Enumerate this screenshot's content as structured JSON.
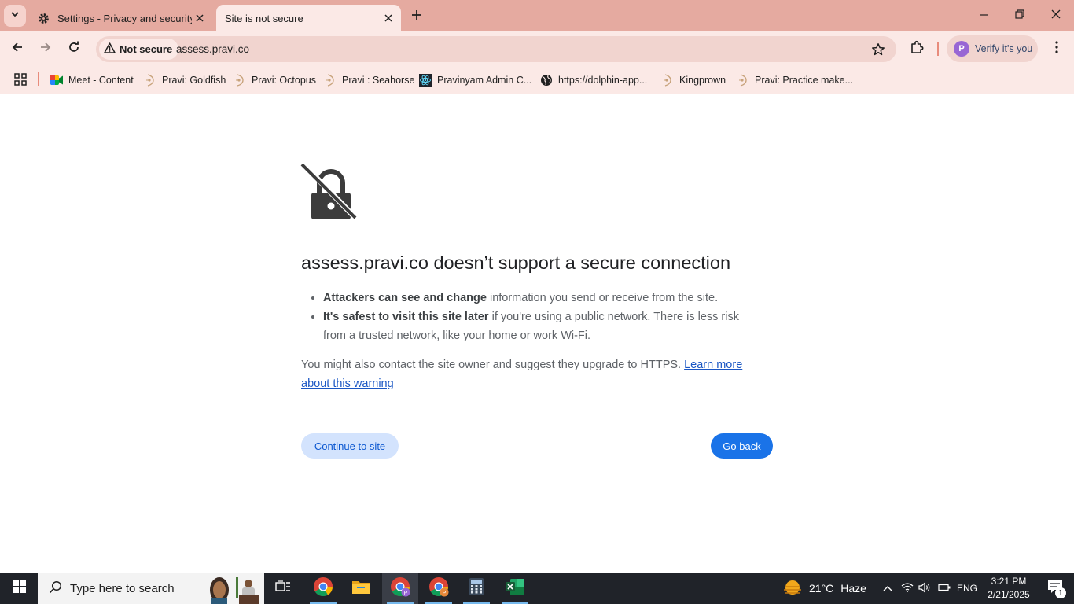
{
  "browser": {
    "tabs": [
      {
        "title": "Settings - Privacy and security",
        "icon": "gear-icon",
        "active": false
      },
      {
        "title": "Site is not secure",
        "icon": null,
        "active": true
      }
    ],
    "omnibox": {
      "security_chip": "Not secure",
      "url": "assess.pravi.co"
    },
    "profile": {
      "initial": "P",
      "label": "Verify it's you",
      "avatar_color": "#9866d4"
    },
    "frame_color": "#e5aaa0",
    "toolbar_color": "#fbe9e6"
  },
  "bookmarks": [
    {
      "label": "Meet - Content",
      "icon": "google-meet-icon"
    },
    {
      "label": "Pravi: Goldfish",
      "icon": "pravi-logo-icon"
    },
    {
      "label": "Pravi: Octopus",
      "icon": "pravi-logo-icon"
    },
    {
      "label": "Pravi : Seahorse",
      "icon": "pravi-logo-icon"
    },
    {
      "label": "Pravinyam Admin C...",
      "icon": "react-atom-icon"
    },
    {
      "label": "https://dolphin-app...",
      "icon": "globe-icon"
    },
    {
      "label": "Kingprown",
      "icon": "pravi-logo-icon"
    },
    {
      "label": "Pravi: Practice make...",
      "icon": "pravi-logo-icon"
    }
  ],
  "interstitial": {
    "icon": "broken-lock-icon",
    "heading": "assess.pravi.co doesn’t support a secure connection",
    "bullets": [
      {
        "bold": "Attackers can see and change",
        "rest": " information you send or receive from the site."
      },
      {
        "bold": "It's safest to visit this site later",
        "rest": " if you're using a public network. There is less risk from a trusted network, like your home or work Wi-Fi."
      }
    ],
    "paragraph": "You might also contact the site owner and suggest they upgrade to HTTPS. ",
    "learn_more": "Learn more about this warning",
    "continue_label": "Continue to site",
    "back_label": "Go back",
    "link_color": "#1a56c4",
    "primary_color": "#1a73e8"
  },
  "taskbar": {
    "search_placeholder": "Type here to search",
    "weather": {
      "temp": "21°C",
      "condition": "Haze"
    },
    "language": "ENG",
    "time": "3:21 PM",
    "date": "2/21/2025",
    "notification_count": "1",
    "apps": [
      "task-view-icon",
      "chrome-icon",
      "file-explorer-icon",
      "chrome-profile-icon",
      "chrome-profile-icon",
      "calculator-icon",
      "excel-icon"
    ]
  }
}
